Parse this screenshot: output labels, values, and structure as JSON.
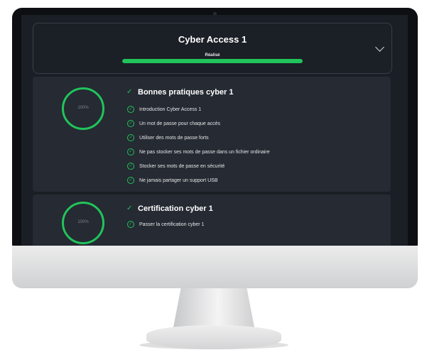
{
  "header": {
    "title": "Cyber Access 1",
    "status": "Réalisé",
    "progress_percent": 100,
    "chevron_icon": "chevron-down-icon"
  },
  "modules": [
    {
      "title": "Bonnes pratiques cyber 1",
      "progress": "100%",
      "lessons": [
        "Introduction Cyber Access 1",
        "Un mot de passe pour chaque accès",
        "Utiliser des mots de passe forts",
        "Ne pas stocker ses mots de passe dans un fichier ordinaire",
        "Stocker ses mots de passe en sécurité",
        "Ne jamais partager un support USB"
      ]
    },
    {
      "title": "Certification cyber 1",
      "progress": "100%",
      "lessons": [
        "Passer la certification cyber 1"
      ]
    }
  ],
  "colors": {
    "accent": "#21c45a",
    "background": "#1a1e25",
    "card": "#252a33"
  }
}
